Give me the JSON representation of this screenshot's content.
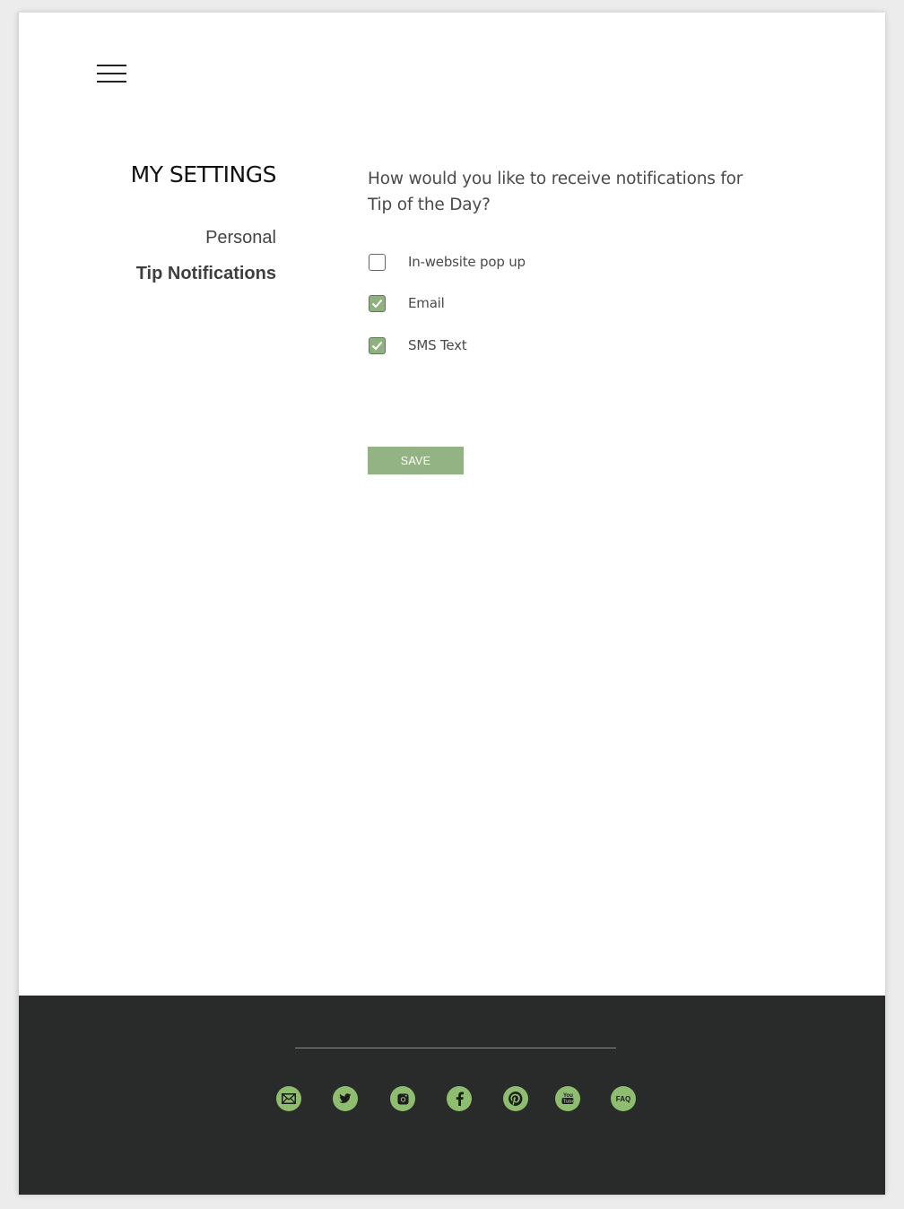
{
  "sidebar": {
    "title": "MY SETTINGS",
    "items": [
      {
        "label": "Personal"
      },
      {
        "label": "Tip Notifications"
      }
    ]
  },
  "main": {
    "question": "How would you like to receive notifications for Tip of the Day?",
    "options": [
      {
        "label": "In-website pop up",
        "checked": false
      },
      {
        "label": "Email",
        "checked": true
      },
      {
        "label": "SMS Text",
        "checked": true
      }
    ],
    "save_label": "SAVE"
  },
  "footer": {
    "social": [
      {
        "icon": "email-icon"
      },
      {
        "icon": "twitter-icon"
      },
      {
        "icon": "instagram-icon"
      },
      {
        "icon": "facebook-icon"
      },
      {
        "icon": "pinterest-icon"
      },
      {
        "icon": "youtube-icon"
      },
      {
        "icon": "faq-icon",
        "label": "FAQ"
      }
    ]
  },
  "colors": {
    "accent": "#94b384",
    "checkbox_checked": "#8fb07f",
    "footer_bg": "#292b2a",
    "social_icon_bg": "#8fbd70"
  }
}
